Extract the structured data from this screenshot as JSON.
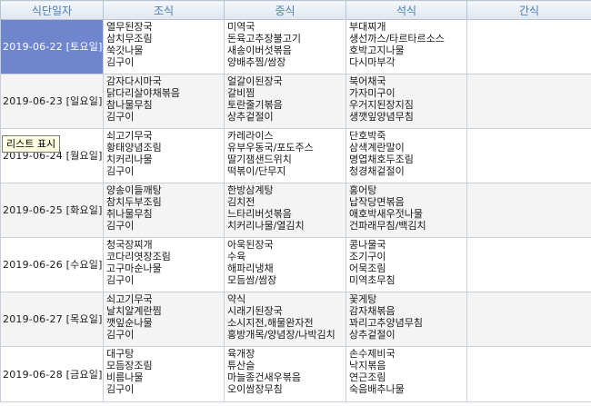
{
  "columns": [
    "식단일자",
    "조식",
    "중식",
    "석식",
    "간식"
  ],
  "rows": [
    {
      "date": "2019-06-22 [토요일]",
      "selected": true,
      "breakfast": [
        "열무된장국",
        "삼치무조림",
        "쑥갓나물",
        "김구이"
      ],
      "lunch": [
        "미역국",
        "돈육고추장불고기",
        "새송이버섯볶음",
        "양배추찜/쌈장"
      ],
      "dinner": [
        "부대찌개",
        "생선까스/타르타르소스",
        "호박고지나물",
        "다시마부각"
      ],
      "snack": []
    },
    {
      "date": "2019-06-23 [일요일]",
      "selected": false,
      "breakfast": [
        "감자다시마국",
        "닭다리살야채볶음",
        "참나물무침",
        "김구이"
      ],
      "lunch": [
        "얼갈이된장국",
        "갈비찜",
        "토란줄기볶음",
        "상추겉절이"
      ],
      "dinner": [
        "북어채국",
        "가자미구이",
        "우거지된장지짐",
        "생깻잎양념무침"
      ],
      "snack": []
    },
    {
      "date": "2019-06-24 [월요일]",
      "selected": false,
      "breakfast": [
        "쇠고기무국",
        "황태양념조림",
        "치커리나물",
        "김구이"
      ],
      "lunch": [
        "카레라이스",
        "유부우동국/포도주스",
        "딸기잼샌드위치",
        "떡볶이/단무지"
      ],
      "dinner": [
        "단호박죽",
        "삼색계란말이",
        "명엽채호두조림",
        "청경채겉절이"
      ],
      "snack": []
    },
    {
      "date": "2019-06-25 [화요일]",
      "selected": false,
      "breakfast": [
        "양송이들깨탕",
        "참치두부조림",
        "취나물무침",
        "김구이"
      ],
      "lunch": [
        "한방삼계탕",
        "김치전",
        "느타리버섯볶음",
        "치커리나물/열김치"
      ],
      "dinner": [
        "홍어탕",
        "납작당면볶음",
        "애호박새우젓나물",
        "건파래무침/백김치"
      ],
      "snack": []
    },
    {
      "date": "2019-06-26 [수요일]",
      "selected": false,
      "breakfast": [
        "청국장찌개",
        "코다리엿장조림",
        "고구마순나물",
        "김구이"
      ],
      "lunch": [
        "아욱된장국",
        "수육",
        "해파리냉채",
        "모듬쌈/쌈장"
      ],
      "dinner": [
        "콩나물국",
        "조기구이",
        "어묵조림",
        "미역초무침"
      ],
      "snack": []
    },
    {
      "date": "2019-06-27 [목요일]",
      "selected": false,
      "breakfast": [
        "쇠고기무국",
        "날치알계란찜",
        "깻잎순나물",
        "김구이"
      ],
      "lunch": [
        "약식",
        "시래기된장국",
        "소시지전,해물완자전",
        "홍방개목/양념장/나박김치"
      ],
      "dinner": [
        "꽃게탕",
        "감자채볶음",
        "꽈리고추양념무침",
        "상추겉절이"
      ],
      "snack": []
    },
    {
      "date": "2019-06-28 [금요일]",
      "selected": false,
      "breakfast": [
        "대구탕",
        "모듬장조림",
        "비름나물",
        "김구이"
      ],
      "lunch": [
        "육개장",
        "튜산슬",
        "마늘종건새우볶음",
        "오이쌈장무침"
      ],
      "dinner": [
        "손수제비국",
        "낙지볶음",
        "연근조림",
        "숙음배추나물"
      ],
      "snack": []
    }
  ],
  "tooltip": "리스트 표시",
  "colors": {
    "header_text": "#4a7fb8",
    "selected_bg": "#6f86cf",
    "alt_row": "#f4f4f4",
    "tooltip_bg": "#ffffe1"
  }
}
